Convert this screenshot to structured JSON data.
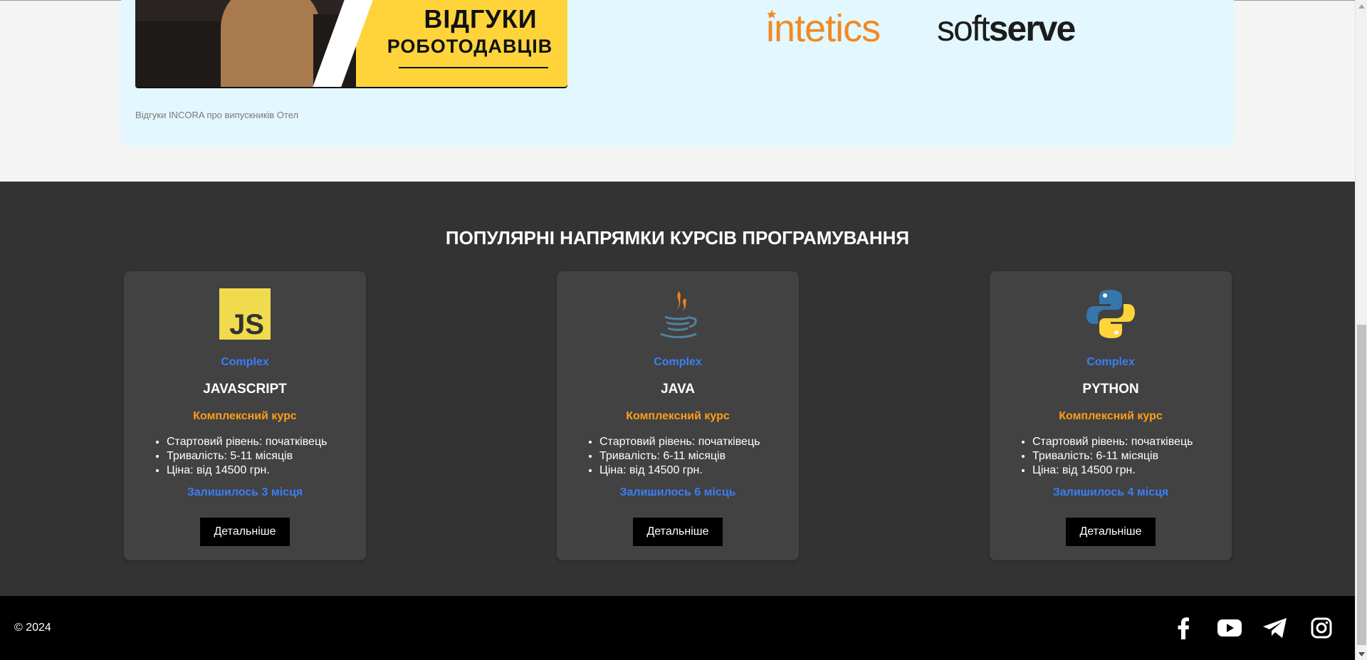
{
  "reviews": {
    "video_heading_line1": "ВІДГУКИ",
    "video_heading_line2": "РОБОТОДАВЦІВ",
    "caption": "Відгуки INCORA про випускників Отел",
    "logos": [
      {
        "name": "intetics",
        "text": "intetics",
        "color": "#f08a24"
      },
      {
        "name": "softserve",
        "text_light": "soft",
        "text_bold": "serve",
        "color": "#1c1c1c"
      }
    ]
  },
  "courses": {
    "title": "ПОПУЛЯРНІ НАПРЯМКИ КУРСІВ ПРОГРАМУВАННЯ",
    "cards": [
      {
        "icon": "javascript-icon",
        "tag": "Complex",
        "name": "JAVASCRIPT",
        "subtitle": "Комплексний курс",
        "features": [
          "Стартовий рівень: початківець",
          "Тривалість: 5-11 місяців",
          "Ціна: від 14500 грн."
        ],
        "remaining": "Залишилось 3 місця",
        "button": "Детальніше"
      },
      {
        "icon": "java-icon",
        "tag": "Complex",
        "name": "JAVA",
        "subtitle": "Комплексний курс",
        "features": [
          "Стартовий рівень: початківець",
          "Тривалість: 6-11 місяців",
          "Ціна: від 14500 грн."
        ],
        "remaining": "Залишилось 6 місць",
        "button": "Детальніше"
      },
      {
        "icon": "python-icon",
        "tag": "Complex",
        "name": "PYTHON",
        "subtitle": "Комплексний курс",
        "features": [
          "Стартовий рівень: початківець",
          "Тривалість: 6-11 місяців",
          "Ціна: від 14500 грн."
        ],
        "remaining": "Залишилось 4 місця",
        "button": "Детальніше"
      }
    ]
  },
  "footer": {
    "copyright": "© 2024",
    "social": [
      "facebook-icon",
      "youtube-icon",
      "telegram-icon",
      "instagram-icon"
    ]
  },
  "colors": {
    "accent_blue": "#3b7ef6",
    "accent_orange": "#ff9e1a",
    "section_bg": "#333333",
    "card_bg": "#424242",
    "panel_bg": "#e3f7ff"
  }
}
